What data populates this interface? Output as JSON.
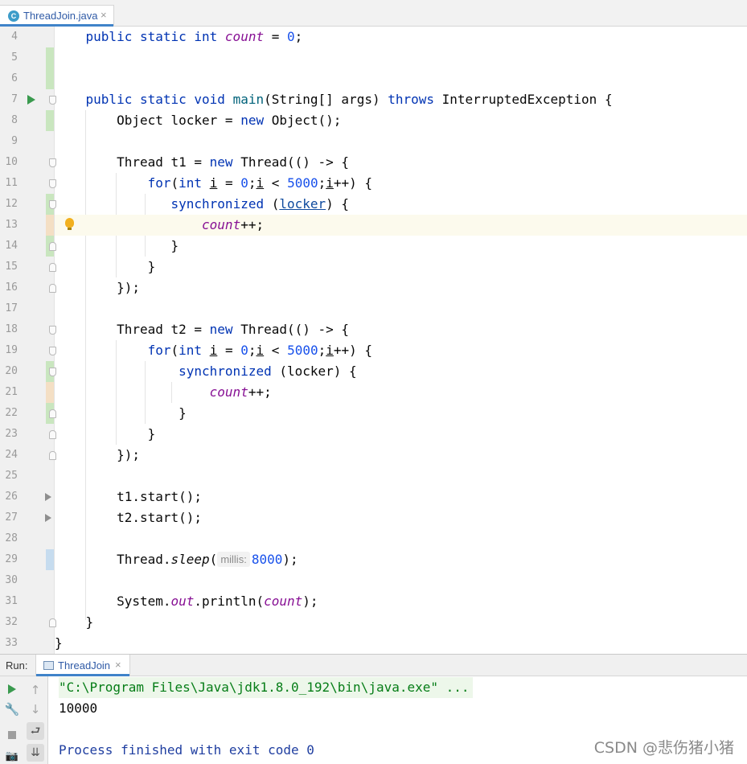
{
  "editor_tab": {
    "icon": "java-class-icon",
    "icon_letter": "C",
    "label": "ThreadJoin.java",
    "close": "×"
  },
  "line_numbers": [
    "4",
    "5",
    "6",
    "7",
    "8",
    "9",
    "10",
    "11",
    "12",
    "13",
    "14",
    "15",
    "16",
    "17",
    "18",
    "19",
    "20",
    "21",
    "22",
    "23",
    "24",
    "25",
    "26",
    "27",
    "28",
    "29",
    "30",
    "31",
    "32",
    "33"
  ],
  "code": {
    "l4": {
      "p1": "    ",
      "kw1": "public static int ",
      "fld": "count",
      "p2": " = ",
      "num": "0",
      "p3": ";"
    },
    "l7": {
      "p1": "    ",
      "kw1": "public static void ",
      "fn": "main",
      "p2": "(String[] args) ",
      "kw2": "throws",
      "p3": " InterruptedException {"
    },
    "l8": {
      "p1": "        Object locker = ",
      "kw1": "new",
      "p2": " Object();"
    },
    "l10": {
      "p1": "        Thread t1 = ",
      "kw1": "new",
      "p2": " Thread(() -> {"
    },
    "l11": {
      "p1": "            ",
      "kw1": "for",
      "p2": "(",
      "kw2": "int",
      "p3": " ",
      "u1": "i",
      "p4": " = ",
      "num1": "0",
      "p5": ";",
      "u2": "i",
      "p6": " < ",
      "num2": "5000",
      "p7": ";",
      "u3": "i",
      "p8": "++) {"
    },
    "l12": {
      "p1": "               ",
      "kw1": "synchronized",
      "p2": " (",
      "ref": "locker",
      "p3": ") {"
    },
    "l13": {
      "p1": "                   ",
      "fld": "count",
      "p2": "++;"
    },
    "l14": {
      "p1": "               }"
    },
    "l15": {
      "p1": "            }"
    },
    "l16": {
      "p1": "        });"
    },
    "l18": {
      "p1": "        Thread t2 = ",
      "kw1": "new",
      "p2": " Thread(() -> {"
    },
    "l19": {
      "p1": "            ",
      "kw1": "for",
      "p2": "(",
      "kw2": "int",
      "p3": " ",
      "u1": "i",
      "p4": " = ",
      "num1": "0",
      "p5": ";",
      "u2": "i",
      "p6": " < ",
      "num2": "5000",
      "p7": ";",
      "u3": "i",
      "p8": "++) {"
    },
    "l20": {
      "p1": "                ",
      "kw1": "synchronized",
      "p2": " (",
      "plain": "locker",
      "p3": ") {"
    },
    "l21": {
      "p1": "                    ",
      "fld": "count",
      "p2": "++;"
    },
    "l22": {
      "p1": "                }"
    },
    "l23": {
      "p1": "            }"
    },
    "l24": {
      "p1": "        });"
    },
    "l26": {
      "p1": "        t1.start();"
    },
    "l27": {
      "p1": "        t2.start();"
    },
    "l29": {
      "p1": "        Thread.",
      "it": "sleep",
      "p2": "(",
      "hint": "millis:",
      "num": "8000",
      "p3": ");"
    },
    "l31": {
      "p1": "        System.",
      "fld": "out",
      "p2": ".println(",
      "fld2": "count",
      "p3": ");"
    },
    "l32": {
      "p1": "    }"
    },
    "l33": {
      "p1": "}"
    }
  },
  "run_panel": {
    "title": "Run:",
    "tab_label": "ThreadJoin",
    "tab_close": "×",
    "tools": {
      "play": "run-icon",
      "wrench": "🔧",
      "stop": "stop-icon",
      "camera": "📷",
      "up": "↑",
      "down": "↓",
      "wrap": "⮐",
      "scroll": "⇊"
    },
    "console": {
      "command": "\"C:\\Program Files\\Java\\jdk1.8.0_192\\bin\\java.exe\" ...",
      "output": "10000",
      "exit": "Process finished with exit code 0"
    }
  },
  "watermark": "CSDN @悲伤猪小猪"
}
